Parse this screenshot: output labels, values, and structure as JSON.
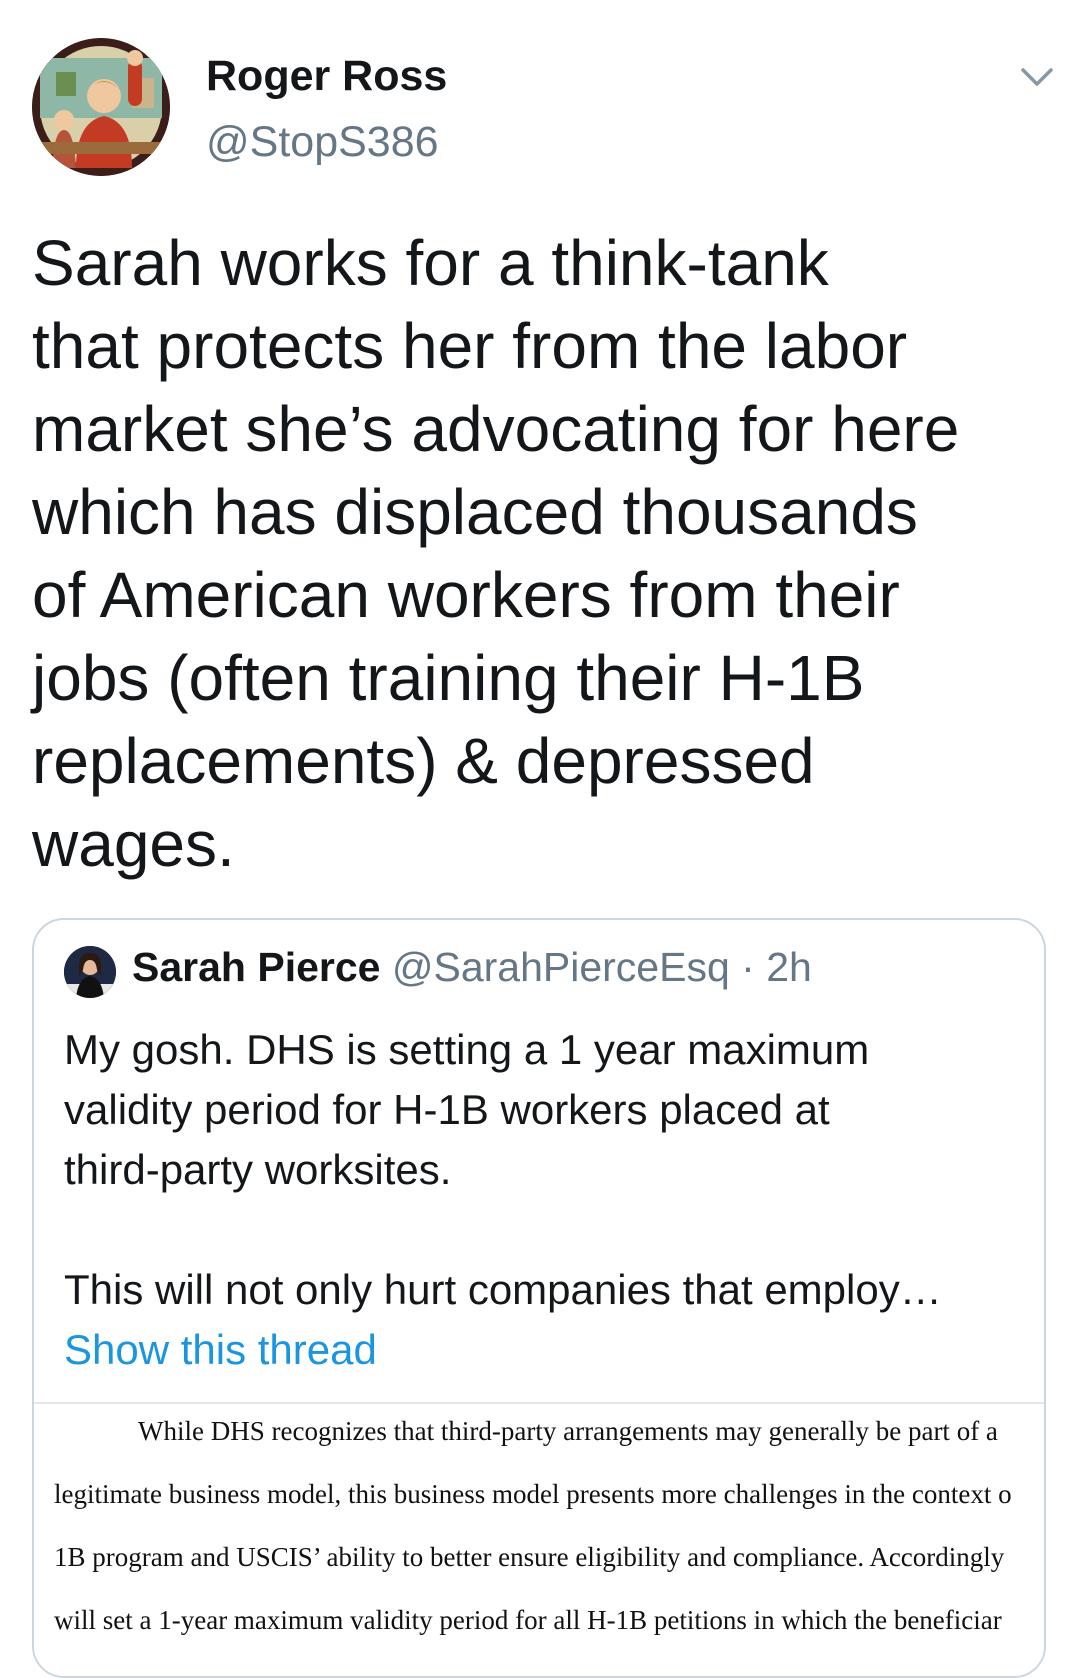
{
  "tweet": {
    "author_name": "Roger Ross",
    "author_handle": "@StopS386",
    "text_lines": [
      "Sarah works for a think-tank",
      "that protects her from the labor",
      "market she’s advocating for here",
      "which has displaced thousands",
      "of American workers from their",
      "jobs (often training their H-1B",
      "replacements) & depressed",
      "wages."
    ],
    "menu_icon": "chevron-down-icon"
  },
  "quoted_tweet": {
    "author_name": "Sarah Pierce",
    "author_handle": "@SarahPierceEsq",
    "separator": "·",
    "time": "2h",
    "lines_1": [
      "My gosh. DHS is setting a 1 year maximum",
      "validity period for H-1B workers placed at",
      "third-party worksites."
    ],
    "line_2": "This will not only hurt companies that employ…",
    "show_thread": "Show this thread",
    "document_lines": [
      "While DHS recognizes that third-party arrangements may generally be part of a",
      "legitimate business model, this business model presents more challenges in the context o",
      "1B program and USCIS’ ability to better ensure eligibility and compliance. Accordingly",
      "will set a 1-year maximum validity period for all H-1B petitions in which the beneficiar"
    ]
  },
  "colors": {
    "text": "#14171a",
    "secondary": "#657786",
    "link": "#1b95e0",
    "border": "#ccd6dd"
  }
}
